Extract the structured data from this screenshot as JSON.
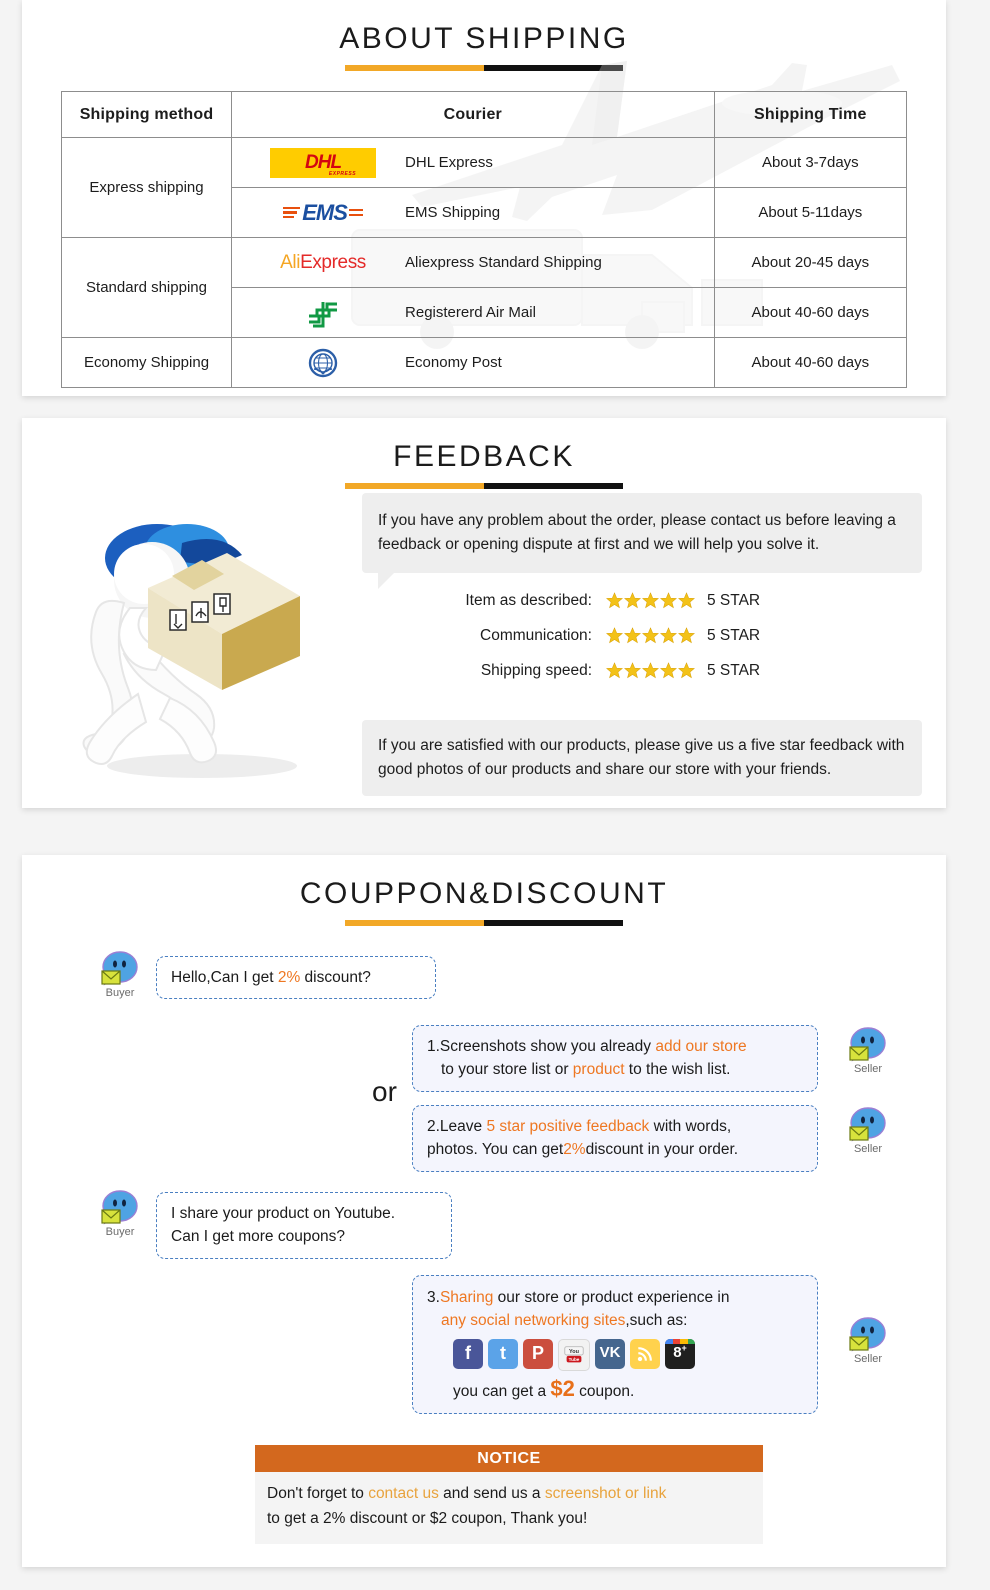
{
  "shipping": {
    "title": "ABOUT SHIPPING",
    "table": {
      "headers": [
        "Shipping method",
        "Courier",
        "Shipping Time"
      ],
      "rows": [
        {
          "method": "Express shipping",
          "logo": "dhl-logo",
          "courier": "DHL Express",
          "time": "About 3-7days"
        },
        {
          "method": "",
          "logo": "ems-logo",
          "courier": "EMS Shipping",
          "time": "About 5-11days"
        },
        {
          "method": "Standard shipping",
          "logo": "aliexpress-logo",
          "courier": "Aliexpress Standard Shipping",
          "time": "About 20-45 days"
        },
        {
          "method": "",
          "logo": "china-post-logo",
          "courier": "Registererd Air Mail",
          "time": "About 40-60 days"
        },
        {
          "method": "Economy Shipping",
          "logo": "un-logo",
          "courier": "Economy Post",
          "time": "About 40-60 days"
        }
      ]
    }
  },
  "feedback": {
    "title": "FEEDBACK",
    "message_top": "If you have any problem about the order, please contact us before leaving a feedback or opening dispute at first and we will help you solve it.",
    "ratings": [
      {
        "label": "Item as described:",
        "stars": 5,
        "value": "5 STAR"
      },
      {
        "label": "Communication:",
        "stars": 5,
        "value": "5 STAR"
      },
      {
        "label": "Shipping speed:",
        "stars": 5,
        "value": "5 STAR"
      }
    ],
    "message_bottom": "If you are satisfied with our products, please give us a five star feedback with good photos of our products and share our store with your friends."
  },
  "coupon": {
    "title": "COUPPON&DISCOUNT",
    "or_label": "or",
    "buyer_label": "Buyer",
    "seller_label": "Seller",
    "bubbles": {
      "buyer1_a": "Hello,Can I get ",
      "buyer1_pct": "2%",
      "buyer1_b": " discount?",
      "seller1_line1_a": "1.Screenshots show you already ",
      "seller1_line1_hl": "add our store",
      "seller1_line2_a": "to your store list or ",
      "seller1_line2_hl": "product",
      "seller1_line2_b": " to the wish list.",
      "seller2_line1_a": "2.Leave ",
      "seller2_line1_hl": "5 star positive feedback",
      "seller2_line1_b": " with words,",
      "seller2_line2_a": "photos. You can get",
      "seller2_line2_pct": "2%",
      "seller2_line2_b": "discount in your order.",
      "buyer2_line1": "I share your product on Youtube.",
      "buyer2_line2": "Can I get more coupons?",
      "seller3_line1_num": "3.",
      "seller3_line1_hl": "Sharing",
      "seller3_line1_b": " our store or product experience in",
      "seller3_line2_hl": "any social networking sites",
      "seller3_line2_b": ",such as:",
      "seller3_line3_a": "you can get a ",
      "seller3_line3_money": "$2",
      "seller3_line3_b": " coupon."
    },
    "socials": [
      "facebook-icon",
      "twitter-icon",
      "pinterest-icon",
      "youtube-icon",
      "vk-icon",
      "rss-icon",
      "google-plus-icon"
    ],
    "notice": {
      "heading": "NOTICE",
      "line1_a": "Don't forget to ",
      "line1_hl1": "contact us",
      "line1_b": " and send us a ",
      "line1_hl2": "screenshot or link",
      "line2": "to get a 2% discount or $2 coupon, Thank you!"
    }
  },
  "colors": {
    "accent_orange": "#f2a827",
    "accent_black": "#111111",
    "highlight": "#EE7722",
    "notice_bar": "#D3681E",
    "star": "#F3C218"
  }
}
